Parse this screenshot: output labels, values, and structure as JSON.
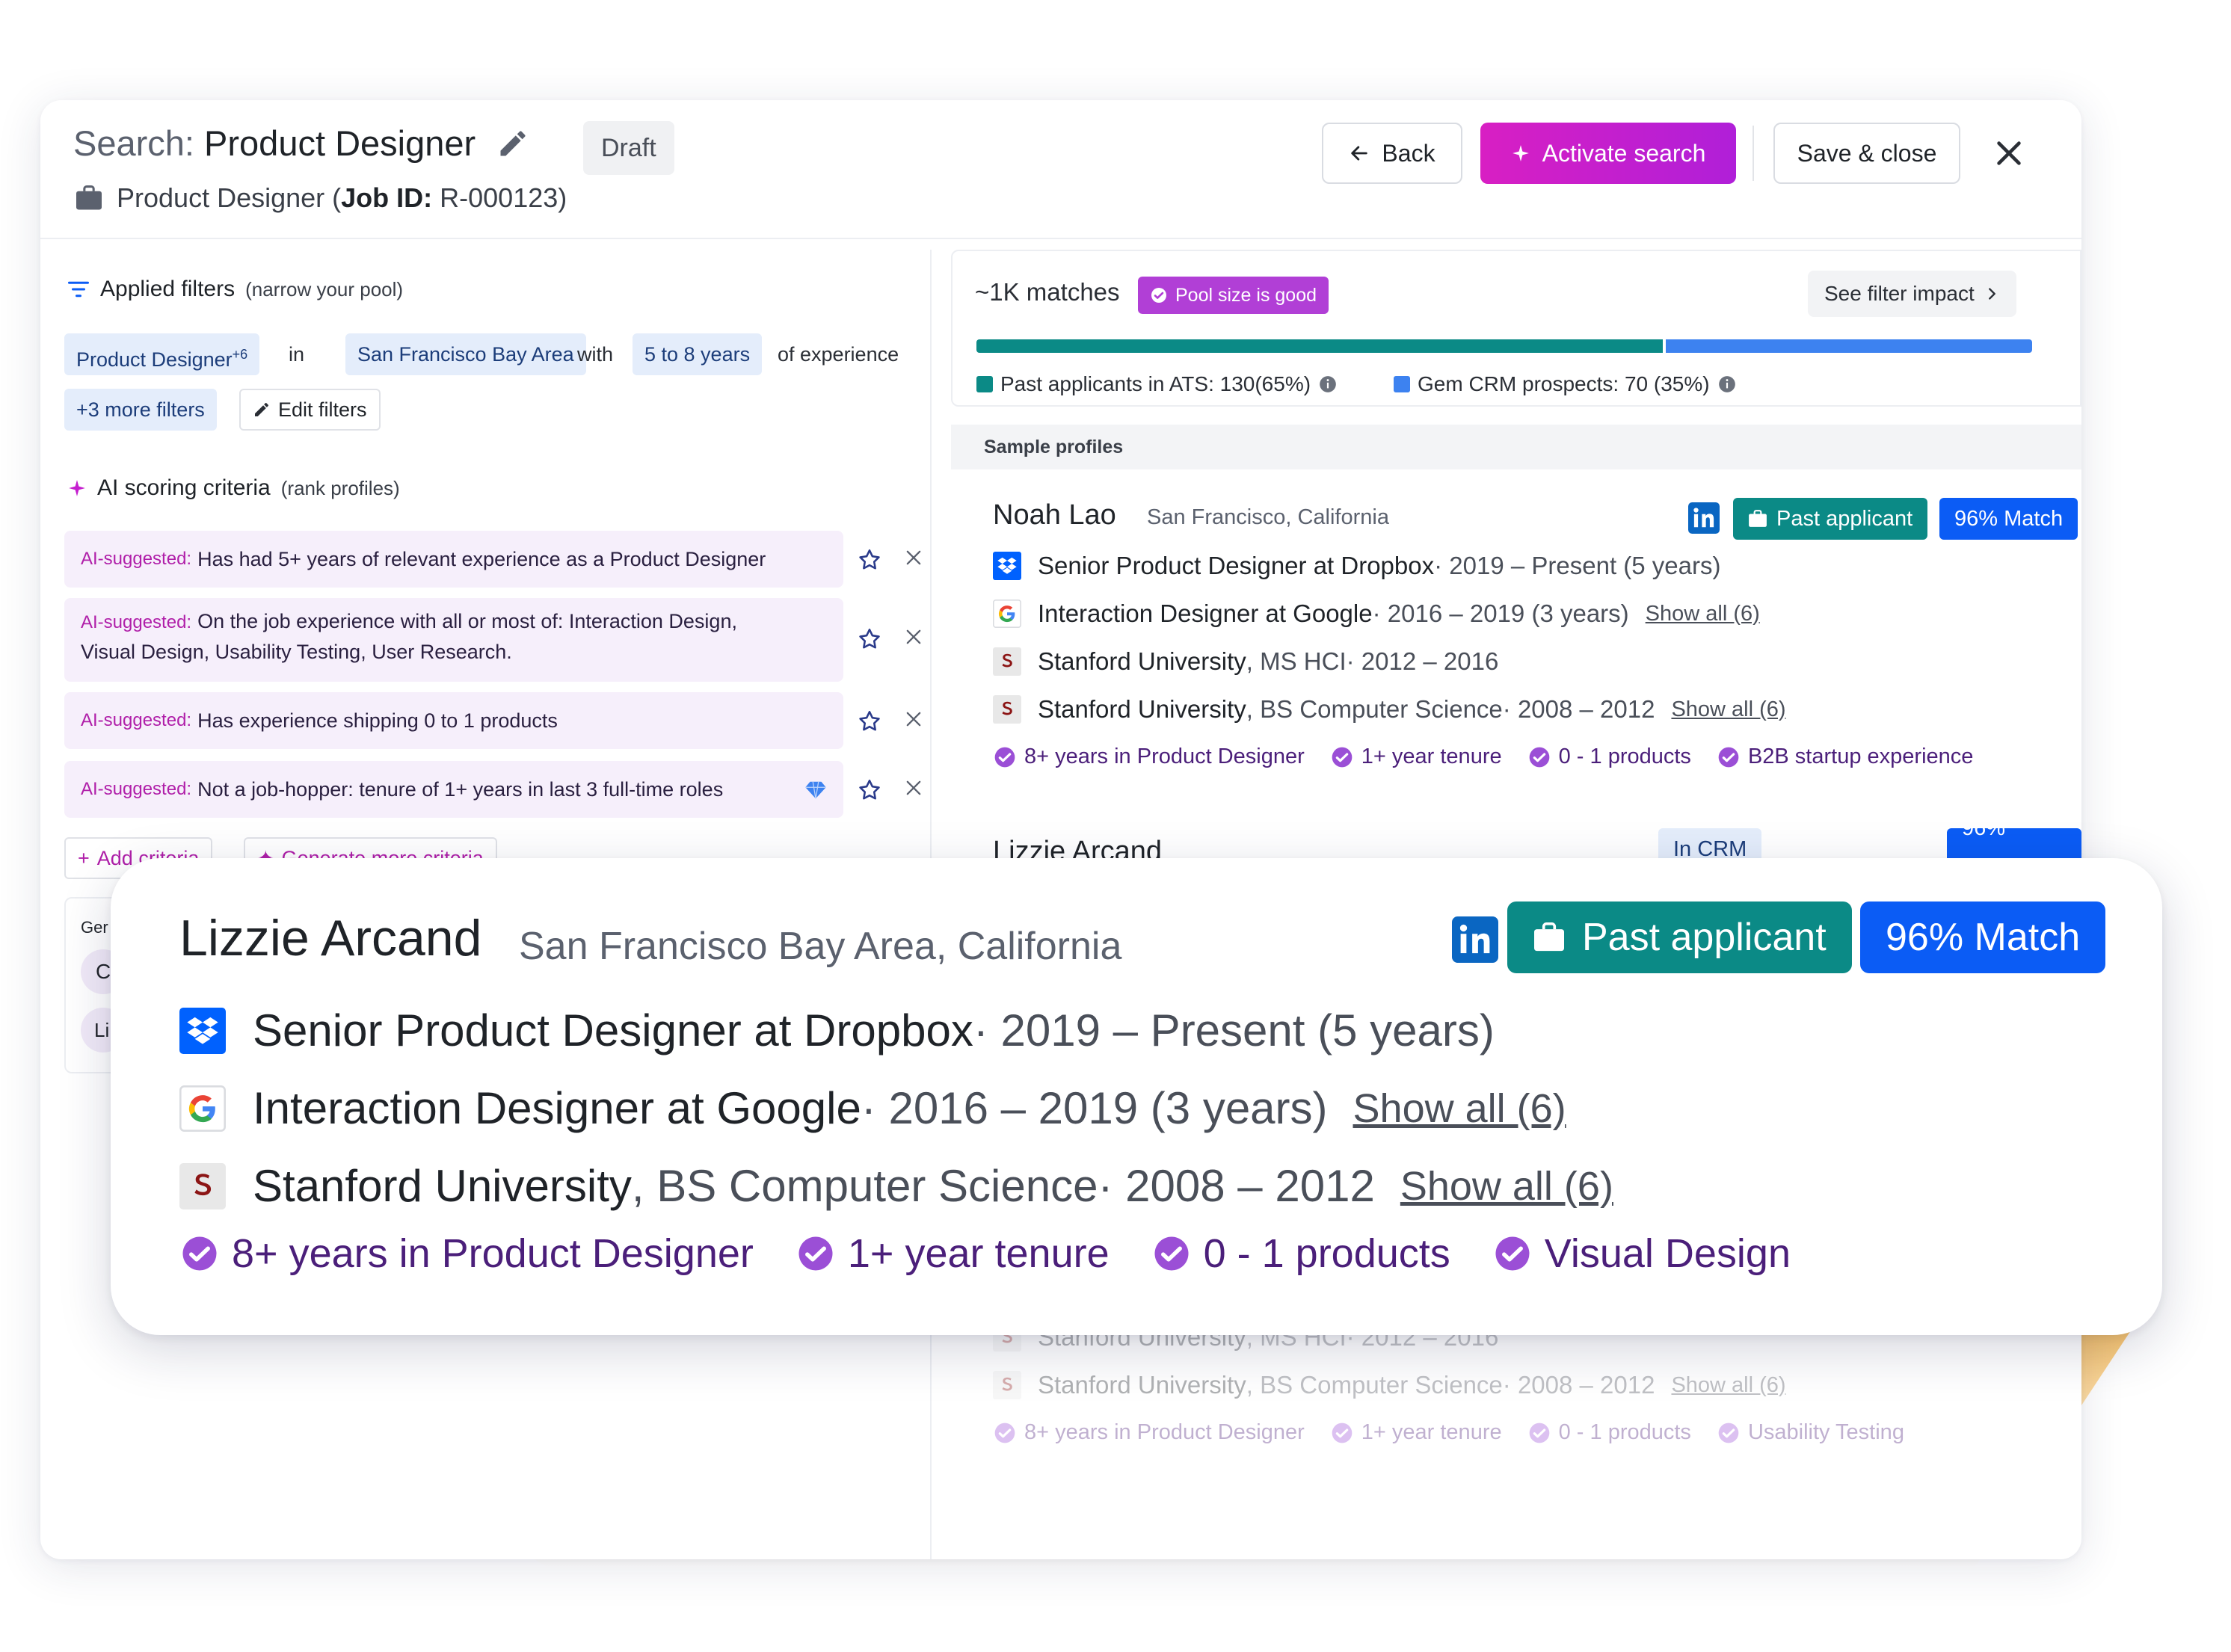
{
  "header": {
    "search_prefix": "Search:",
    "search_title": "Product Designer",
    "status": "Draft",
    "job_name": "Product Designer",
    "job_id_label": "Job ID:",
    "job_id": "R-000123",
    "back_label": "Back",
    "activate_label": "Activate search",
    "save_label": "Save & close"
  },
  "filters": {
    "title": "Applied filters",
    "subtitle": "(narrow your pool)",
    "role": "Product Designer",
    "role_more": "+6",
    "in_word": "in",
    "location": "San Francisco Bay Area",
    "with_word": "with",
    "experience": "5 to 8 years",
    "of_experience": "of experience",
    "more_filters": "+3 more filters",
    "edit_label": "Edit filters"
  },
  "scoring": {
    "title": "AI scoring criteria",
    "subtitle": "(rank profiles)",
    "ai_prefix": "AI-suggested:",
    "criteria": [
      {
        "text": "Has had 5+ years of relevant experience as a Product Designer"
      },
      {
        "text": "On the job experience with all or most of: Interaction Design,",
        "text2": "Visual Design, Usability Testing, User Research."
      },
      {
        "text": "Has experience shipping 0 to 1 products"
      },
      {
        "text": "Not a job-hopper: tenure of 1+ years in last 3 full-time roles"
      }
    ],
    "add_label": "Add criteria",
    "generate_label": "Generate more criteria",
    "partial_gen": "Ger",
    "partial_c": "C",
    "partial_li": "Li"
  },
  "matches": {
    "count": "~1K matches",
    "pool_status": "Pool size is good",
    "impact_label": "See filter impact",
    "ats_label": "Past applicants in ATS: 130(65%)",
    "crm_label": "Gem CRM prospects: 70 (35%)",
    "ats_share": 0.65,
    "crm_share": 0.35,
    "ats_color": "#0b8a86",
    "crm_color": "#3d82f0"
  },
  "sample": {
    "header": "Sample profiles",
    "profile1": {
      "name": "Noah Lao",
      "location": "San Francisco, California",
      "badge_past": "Past applicant",
      "badge_match": "96% Match",
      "rows": [
        {
          "main": "Senior Product Designer at Dropbox",
          "dim": " · 2019 – Present (5 years)"
        },
        {
          "main": "Interaction Designer at Google",
          "dim": " · 2016 – 2019 (3 years)",
          "link": "Show all (6)"
        },
        {
          "main": "Stanford University",
          "dim2": ", MS HCI",
          "dim": " · 2012 – 2016"
        },
        {
          "main": "Stanford University",
          "dim2": ", BS Computer Science",
          "dim": " · 2008 – 2012",
          "link": "Show all (6)"
        }
      ],
      "tags": [
        "8+ years in Product Designer",
        "1+ year tenure",
        "0 - 1 products",
        "B2B startup experience"
      ]
    },
    "profile2_partial": {
      "name": "Lizzie Arcand",
      "badge_crm": "In CRM",
      "badge_match": "96% Match"
    },
    "ghost": {
      "row1_main": "Stanford University",
      "row1_dim2": ", MS HCI",
      "row1_dim": " · 2012 – 2016",
      "row2_main": "Stanford University",
      "row2_dim2": ", BS Computer Science",
      "row2_dim": " · 2008 – 2012",
      "row2_link": "Show all (6)",
      "tags": [
        "8+ years in Product Designer",
        "1+ year tenure",
        "0 - 1 products",
        "Usability Testing"
      ]
    }
  },
  "highlight": {
    "name": "Lizzie Arcand",
    "location": "San Francisco Bay Area, California",
    "badge_past": "Past applicant",
    "badge_match": "96% Match",
    "rows": [
      {
        "main": "Senior Product Designer at Dropbox",
        "dim": " · 2019 – Present (5 years)"
      },
      {
        "main": "Interaction Designer at Google",
        "dim": " · 2016 – 2019 (3 years)",
        "link": "Show all (6)"
      },
      {
        "main": "Stanford University",
        "dim2": ", BS Computer Science",
        "dim": " · 2008 – 2012",
        "link": "Show all (6)"
      }
    ],
    "tags": [
      "8+ years in Product Designer",
      "1+ year tenure",
      "0 - 1 products",
      "Visual Design"
    ]
  },
  "colors": {
    "accent_magenta": "#c51fcf",
    "teal": "#0b8a86",
    "match_blue": "#0b5cf5",
    "tag_purple": "#9b4fd6"
  }
}
